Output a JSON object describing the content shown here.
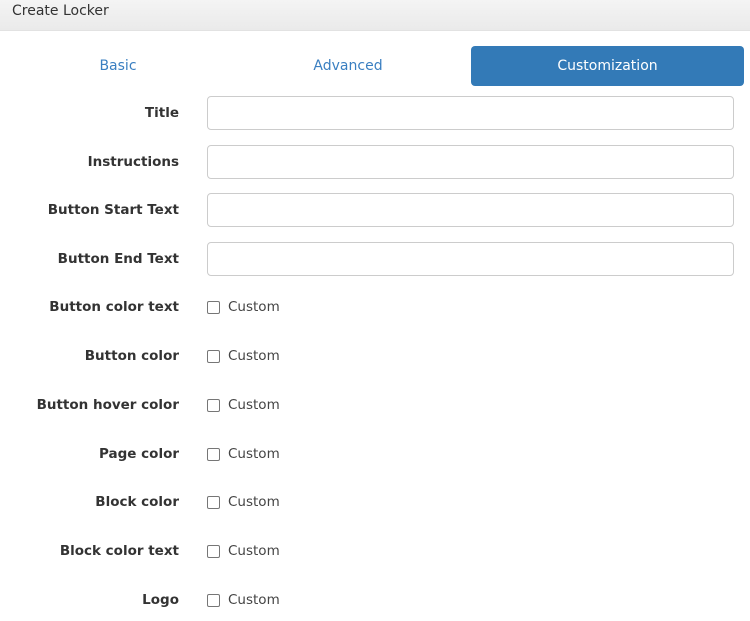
{
  "window": {
    "title": "Create Locker"
  },
  "tabs": {
    "basic": "Basic",
    "advanced": "Advanced",
    "customization": "Customization",
    "active": "customization"
  },
  "fields": {
    "title": {
      "label": "Title",
      "value": ""
    },
    "instructions": {
      "label": "Instructions",
      "value": ""
    },
    "button_start_text": {
      "label": "Button Start Text",
      "value": ""
    },
    "button_end_text": {
      "label": "Button End Text",
      "value": ""
    }
  },
  "options": {
    "button_color_text": {
      "label": "Button color text",
      "checkbox": "Custom",
      "checked": false
    },
    "button_color": {
      "label": "Button color",
      "checkbox": "Custom",
      "checked": false
    },
    "button_hover_color": {
      "label": "Button hover color",
      "checkbox": "Custom",
      "checked": false
    },
    "page_color": {
      "label": "Page color",
      "checkbox": "Custom",
      "checked": false
    },
    "block_color": {
      "label": "Block color",
      "checkbox": "Custom",
      "checked": false
    },
    "block_color_text": {
      "label": "Block color text",
      "checkbox": "Custom",
      "checked": false
    },
    "logo": {
      "label": "Logo",
      "checkbox": "Custom",
      "checked": false
    }
  },
  "colors": {
    "accent": "#337ab7",
    "tab_link": "#3a7fc1"
  }
}
